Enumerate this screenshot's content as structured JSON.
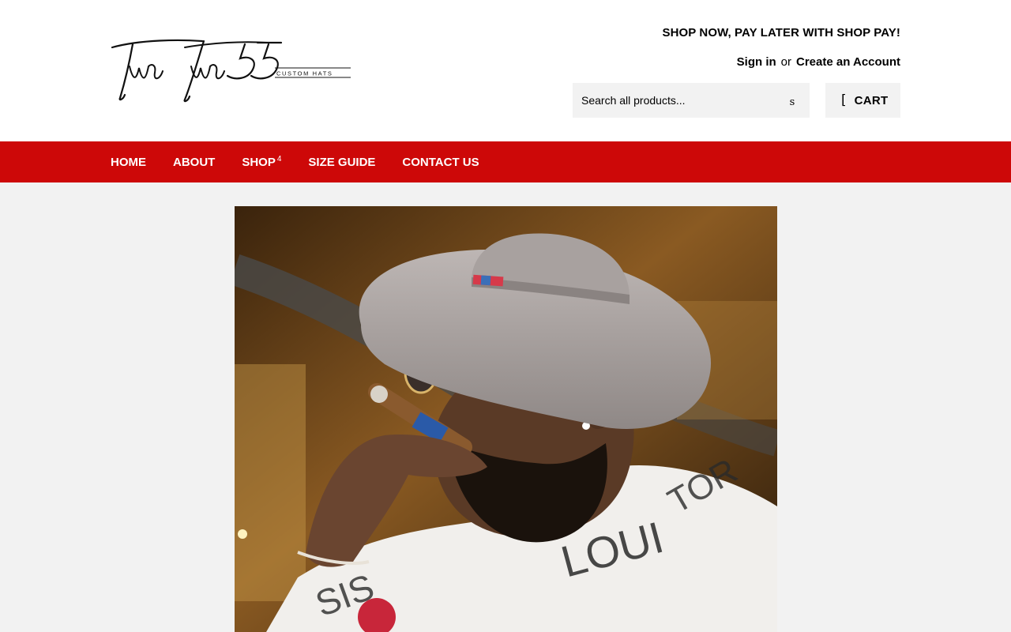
{
  "brand": {
    "logo_script": "TwoTwo55",
    "logo_tagline": "CUSTOM HATS"
  },
  "header": {
    "promo": "SHOP NOW, PAY LATER WITH SHOP PAY!",
    "sign_in": "Sign in",
    "or": "or",
    "create_account": "Create an Account",
    "search_placeholder": "Search all products...",
    "search_button_glyph": "s",
    "cart_icon_glyph": "[",
    "cart_label": "CART"
  },
  "nav": {
    "items": [
      {
        "label": "HOME"
      },
      {
        "label": "ABOUT"
      },
      {
        "label": "SHOP",
        "caret": "4"
      },
      {
        "label": "SIZE GUIDE"
      },
      {
        "label": "CONTACT US"
      }
    ]
  },
  "colors": {
    "nav_background": "#cd0808",
    "page_background": "#f2f2f2",
    "header_background": "#ffffff"
  },
  "hero": {
    "image_alt": "Bearded man in a grey wide-brim custom hat and aviator sunglasses smoking a cigar"
  }
}
